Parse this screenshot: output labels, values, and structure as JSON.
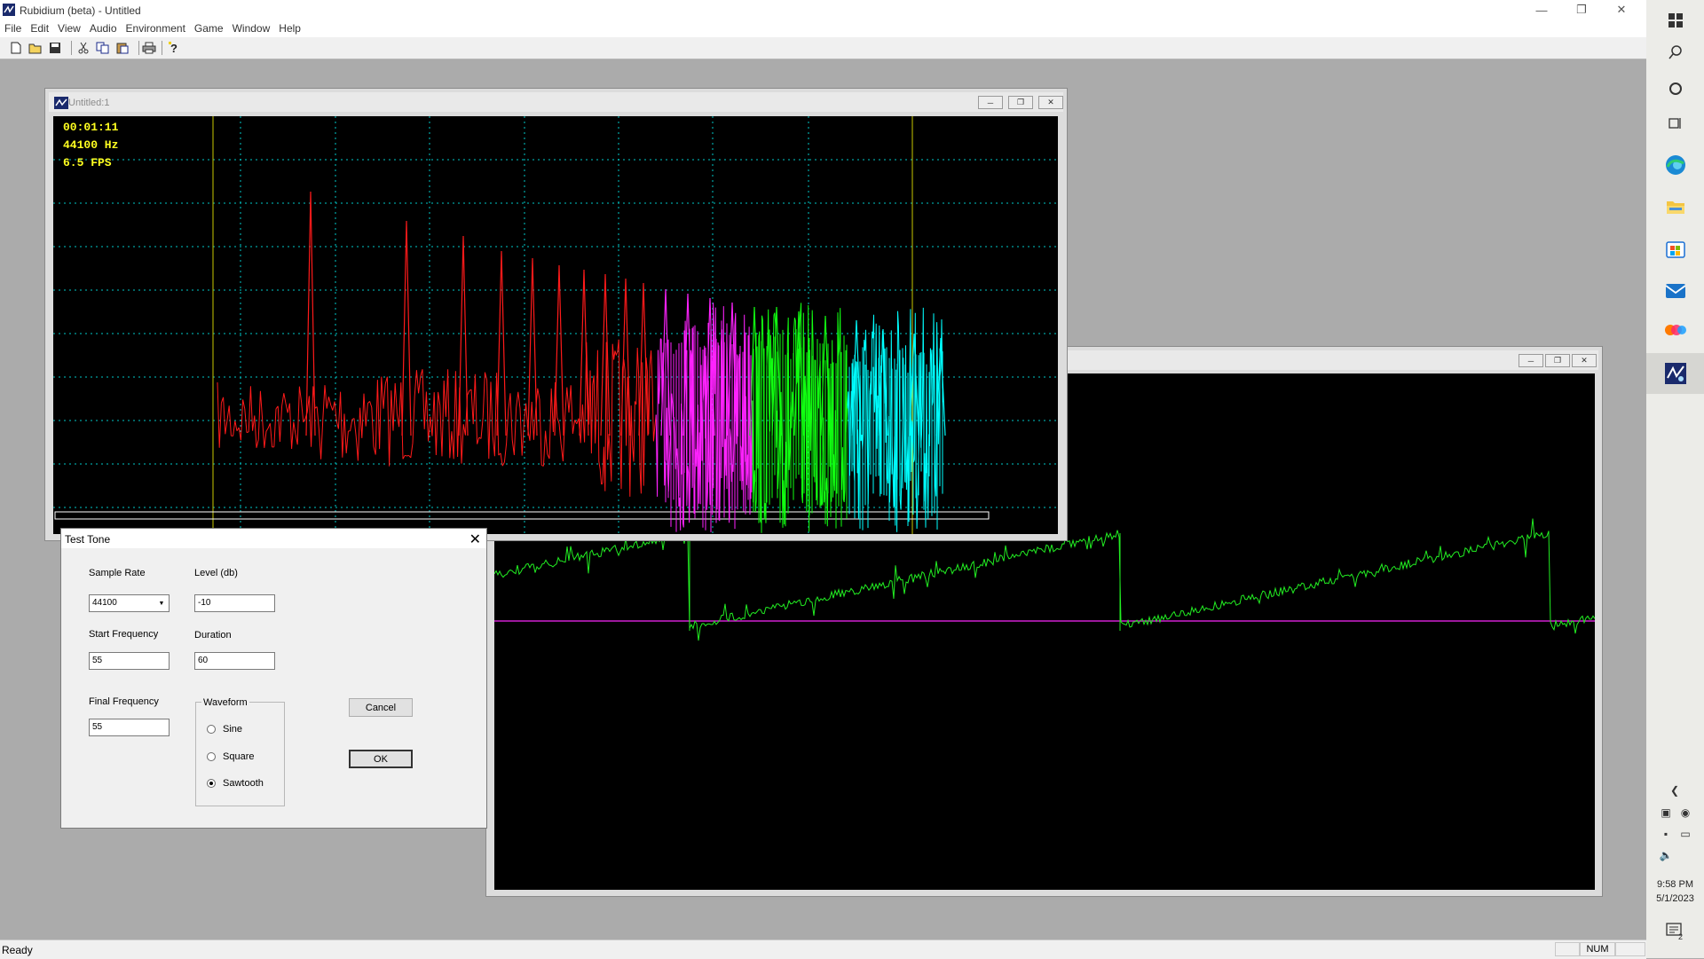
{
  "app": {
    "title": "Rubidium (beta) - Untitled",
    "menu": [
      "File",
      "Edit",
      "View",
      "Audio",
      "Environment",
      "Game",
      "Window",
      "Help"
    ],
    "toolbar_icons": [
      "new-icon",
      "open-icon",
      "save-icon",
      "cut-icon",
      "copy-icon",
      "paste-icon",
      "print-icon",
      "help-icon"
    ]
  },
  "spectrum_window": {
    "title": "Untitled:1",
    "osd": {
      "time": "00:01:11",
      "rate": "44100 Hz",
      "fps": "6.5 FPS"
    },
    "colors": {
      "low": "#ff1a1a",
      "mid": "#ff22ff",
      "high": "#11ff11",
      "top": "#00ffff",
      "marker": "#c8c800",
      "grid": "#00c8c8"
    }
  },
  "waveform_window": {
    "title": "",
    "colors": {
      "trace": "#22ee22",
      "baseline": "#d020d0"
    }
  },
  "dialog": {
    "title": "Test Tone",
    "sample_rate": {
      "label": "Sample Rate",
      "value": "44100"
    },
    "level": {
      "label": "Level (db)",
      "value": "-10"
    },
    "start_frequency": {
      "label": "Start Frequency",
      "value": "55"
    },
    "duration": {
      "label": "Duration",
      "value": "60"
    },
    "final_frequency": {
      "label": "Final Frequency",
      "value": "55"
    },
    "waveform": {
      "label": "Waveform",
      "options": [
        {
          "label": "Sine",
          "selected": false
        },
        {
          "label": "Square",
          "selected": false
        },
        {
          "label": "Sawtooth",
          "selected": true
        }
      ]
    },
    "cancel_label": "Cancel",
    "ok_label": "OK"
  },
  "statusbar": {
    "status": "Ready",
    "num_indicator": "NUM"
  },
  "taskbar": {
    "icons": [
      "windows-start-icon",
      "search-icon",
      "cortana-icon",
      "task-view-icon",
      "edge-icon",
      "file-explorer-icon",
      "store-icon",
      "mail-icon",
      "app-icon",
      "rubidium-app-icon"
    ],
    "tray_icons": [
      "chevron-left-icon",
      "network-icon",
      "wifi-icon",
      "notification-icon",
      "display-icon",
      "volume-icon"
    ],
    "time": "9:58 PM",
    "date": "5/1/2023",
    "notification_count": "2"
  }
}
